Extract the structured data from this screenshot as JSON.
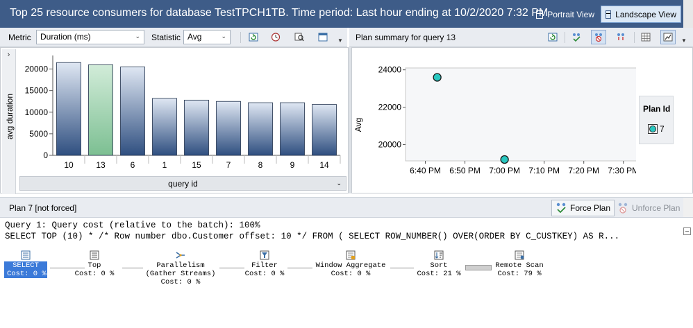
{
  "title": "Top 25 resource consumers for database TestTPCH1TB. Time period: Last hour ending at 10/2/2020 7:32 PM",
  "views": {
    "portrait": "Portrait View",
    "landscape": "Landscape View"
  },
  "left_toolbar": {
    "metric_label": "Metric",
    "metric_value": "Duration (ms)",
    "statistic_label": "Statistic",
    "statistic_value": "Avg",
    "icons": [
      "refresh-icon",
      "clock-icon",
      "query-details-icon",
      "grid-view-icon"
    ]
  },
  "right_toolbar": {
    "title": "Plan summary for query 13",
    "icons": [
      "refresh-icon",
      "force-plan-icon",
      "unforce-plan-icon",
      "compare-plans-icon",
      "grid-view-icon",
      "chart-view-icon"
    ]
  },
  "colors": {
    "titlebar": "#3e5c88",
    "bar": "#3f5f92",
    "bar_selected": "#8fc9a3",
    "point": "#28c7c0",
    "selection": "#3b7ad9"
  },
  "chart_data": [
    {
      "type": "bar",
      "categories": [
        "10",
        "13",
        "6",
        "1",
        "15",
        "7",
        "8",
        "9",
        "14"
      ],
      "values": [
        21500,
        21000,
        20500,
        13200,
        12800,
        12500,
        12200,
        12200,
        11800
      ],
      "selected_category": "13",
      "xlabel": "query id",
      "ylabel": "avg duration",
      "ylim": [
        0,
        22500
      ],
      "yticks": [
        "0",
        "5000",
        "10000",
        "15000",
        "20000"
      ],
      "yticks_values": [
        0,
        5000,
        10000,
        15000,
        20000
      ]
    },
    {
      "type": "scatter",
      "xlabel": "",
      "ylabel": "Avg",
      "xticks": [
        "6:40 PM",
        "6:50 PM",
        "7:00 PM",
        "7:10 PM",
        "7:20 PM",
        "7:30 PM"
      ],
      "xlim": [
        "6:35 PM",
        "7:36 PM"
      ],
      "yticks": [
        "20000",
        "22000",
        "24000"
      ],
      "ylim": [
        19200,
        24100
      ],
      "series": [
        {
          "name": "7",
          "points": [
            {
              "x": "6:43 PM",
              "y": 23600
            },
            {
              "x": "7:00 PM",
              "y": 19200
            }
          ]
        }
      ],
      "legend_title": "Plan Id",
      "legend_position": "right"
    }
  ],
  "left_footer": {
    "label": "query id"
  },
  "plan_bar": {
    "label": "Plan 7 [not forced]",
    "force": "Force Plan",
    "unforce": "Unforce Plan"
  },
  "query": {
    "line1": "Query 1: Query cost (relative to the batch): 100%",
    "line2": "SELECT TOP (10) * /* Row number dbo.Customer offset: 10 */ FROM ( SELECT ROW_NUMBER() OVER(ORDER BY C_CUSTKEY) AS R..."
  },
  "plan_ops": [
    {
      "name": "SELECT",
      "cost": "Cost: 0 %",
      "icon": "select-icon"
    },
    {
      "name": "Top",
      "cost": "Cost: 0 %",
      "icon": "top-icon"
    },
    {
      "name": "Parallelism",
      "sub": "(Gather Streams)",
      "cost": "Cost: 0 %",
      "icon": "parallelism-icon"
    },
    {
      "name": "Filter",
      "cost": "Cost: 0 %",
      "icon": "filter-icon"
    },
    {
      "name": "Window Aggregate",
      "cost": "Cost: 0 %",
      "icon": "window-aggregate-icon"
    },
    {
      "name": "Sort",
      "cost": "Cost: 21 %",
      "icon": "sort-icon"
    },
    {
      "name": "Remote Scan",
      "cost": "Cost: 79 %",
      "icon": "remote-scan-icon"
    }
  ]
}
